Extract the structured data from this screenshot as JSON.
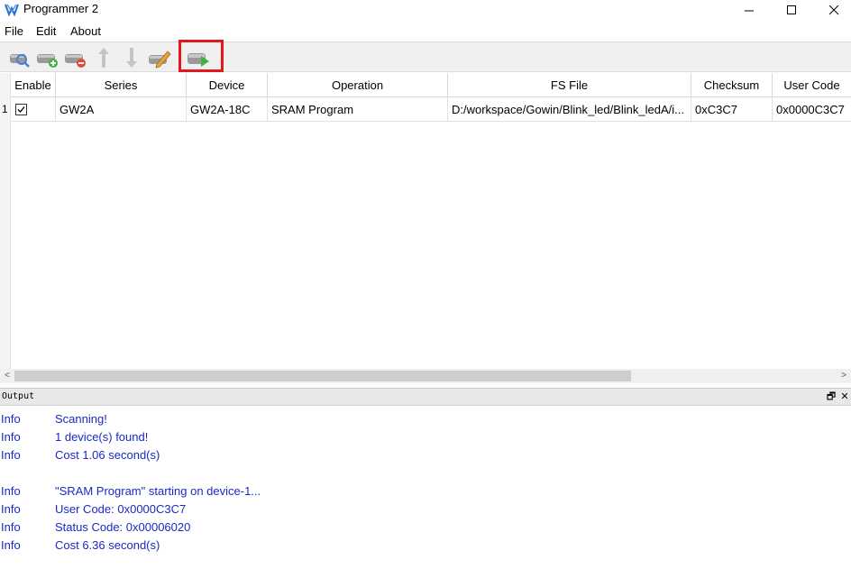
{
  "window": {
    "title": "Programmer 2",
    "controls": {
      "minimize": "—",
      "maximize": "☐",
      "close": "✕"
    }
  },
  "menu": [
    "File",
    "Edit",
    "About"
  ],
  "toolbar": {
    "buttons": [
      {
        "name": "scan-device",
        "icon": "scan-icon"
      },
      {
        "name": "add-device",
        "icon": "add-device-icon"
      },
      {
        "name": "remove-device",
        "icon": "remove-device-icon"
      },
      {
        "name": "move-up",
        "icon": "arrow-up-icon"
      },
      {
        "name": "move-down",
        "icon": "arrow-down-icon"
      },
      {
        "name": "edit-device",
        "icon": "edit-icon"
      },
      {
        "name": "program-run",
        "icon": "program-run-icon"
      }
    ],
    "highlight_color": "#e0191f"
  },
  "table": {
    "columns": [
      "Enable",
      "Series",
      "Device",
      "Operation",
      "FS File",
      "Checksum",
      "User Code"
    ],
    "rows": [
      {
        "index": "1",
        "enable": true,
        "series": "GW2A",
        "device": "GW2A-18C",
        "operation": "SRAM Program",
        "fs_file": "D:/workspace/Gowin/Blink_led/Blink_ledA/i...",
        "checksum": "0xC3C7",
        "user_code": "0x0000C3C7"
      }
    ]
  },
  "scrollbar": {
    "left_arrow": "<",
    "right_arrow": ">"
  },
  "output": {
    "title": "Output",
    "float_button": "🗗",
    "close_button": "✕",
    "text_color": "#1a29c7",
    "log": [
      {
        "level": "Info",
        "message": "Scanning!"
      },
      {
        "level": "Info",
        "message": "1 device(s) found!"
      },
      {
        "level": "Info",
        "message": "Cost 1.06 second(s)"
      },
      {
        "level": "",
        "message": ""
      },
      {
        "level": "Info",
        "message": "\"SRAM Program\" starting on device-1..."
      },
      {
        "level": "Info",
        "message": "User Code: 0x0000C3C7"
      },
      {
        "level": "Info",
        "message": "Status Code: 0x00006020"
      },
      {
        "level": "Info",
        "message": "Cost 6.36 second(s)"
      }
    ]
  }
}
